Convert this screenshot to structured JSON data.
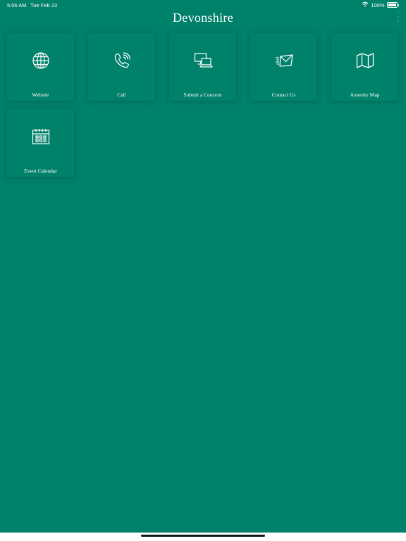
{
  "status_bar": {
    "time": "5:06 AM",
    "date": "Tue Feb 23",
    "battery": "100%",
    "battery_level": 1.0,
    "wifi_icon": "wifi-icon"
  },
  "app": {
    "title": "Devonshire",
    "menu_icon": "more-vertical-icon"
  },
  "tiles": [
    {
      "label": "Website",
      "icon": "globe-icon"
    },
    {
      "label": "Call",
      "icon": "phone-icon"
    },
    {
      "label": "Submit a Concern",
      "icon": "computers-icon"
    },
    {
      "label": "Contact Us",
      "icon": "send-mail-icon"
    },
    {
      "label": "Amenity Map",
      "icon": "map-icon"
    },
    {
      "label": "Event Calendar",
      "icon": "calendar-icon"
    }
  ],
  "colors": {
    "background": "#00816a",
    "text": "#ffffff"
  }
}
